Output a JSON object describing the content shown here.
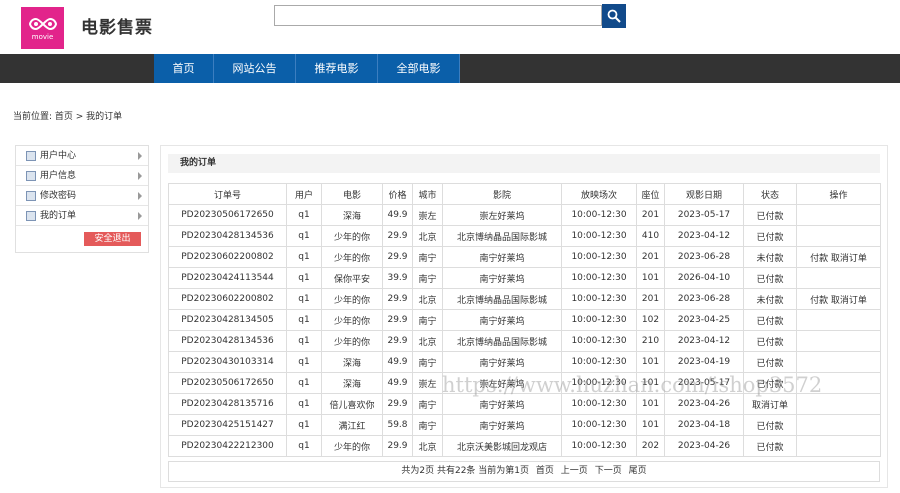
{
  "header": {
    "logo_text": "movie",
    "site_title": "电影售票",
    "search": {
      "value": "",
      "placeholder": ""
    }
  },
  "nav": [
    "首页",
    "网站公告",
    "推荐电影",
    "全部电影"
  ],
  "breadcrumb": "当前位置: 首页 > 我的订单",
  "sidebar": {
    "items": [
      "用户中心",
      "用户信息",
      "修改密码",
      "我的订单"
    ],
    "logout": "安全退出"
  },
  "content": {
    "title": "我的订单",
    "columns": [
      "订单号",
      "用户",
      "电影",
      "价格",
      "城市",
      "影院",
      "放映场次",
      "座位",
      "观影日期",
      "状态",
      "操作"
    ],
    "rows": [
      [
        "PD20230506172650",
        "q1",
        "深海",
        "49.9",
        "崇左",
        "崇左好莱坞",
        "10:00-12:30",
        "201",
        "2023-05-17",
        "已付款",
        ""
      ],
      [
        "PD20230428134536",
        "q1",
        "少年的你",
        "29.9",
        "北京",
        "北京博纳晶品国际影城",
        "10:00-12:30",
        "410",
        "2023-04-12",
        "已付款",
        ""
      ],
      [
        "PD20230602200802",
        "q1",
        "少年的你",
        "29.9",
        "南宁",
        "南宁好莱坞",
        "10:00-12:30",
        "201",
        "2023-06-28",
        "未付款",
        "付款 取消订单"
      ],
      [
        "PD20230424113544",
        "q1",
        "保你平安",
        "39.9",
        "南宁",
        "南宁好莱坞",
        "10:00-12:30",
        "101",
        "2026-04-10",
        "已付款",
        ""
      ],
      [
        "PD20230602200802",
        "q1",
        "少年的你",
        "29.9",
        "北京",
        "北京博纳晶品国际影城",
        "10:00-12:30",
        "201",
        "2023-06-28",
        "未付款",
        "付款 取消订单"
      ],
      [
        "PD20230428134505",
        "q1",
        "少年的你",
        "29.9",
        "南宁",
        "南宁好莱坞",
        "10:00-12:30",
        "102",
        "2023-04-25",
        "已付款",
        ""
      ],
      [
        "PD20230428134536",
        "q1",
        "少年的你",
        "29.9",
        "北京",
        "北京博纳晶品国际影城",
        "10:00-12:30",
        "210",
        "2023-04-12",
        "已付款",
        ""
      ],
      [
        "PD20230430103314",
        "q1",
        "深海",
        "49.9",
        "南宁",
        "南宁好莱坞",
        "10:00-12:30",
        "101",
        "2023-04-19",
        "已付款",
        ""
      ],
      [
        "PD20230506172650",
        "q1",
        "深海",
        "49.9",
        "崇左",
        "崇左好莱坞",
        "10:00-12:30",
        "101",
        "2023-05-17",
        "已付款",
        ""
      ],
      [
        "PD20230428135716",
        "q1",
        "倍儿喜欢你",
        "29.9",
        "南宁",
        "南宁好莱坞",
        "10:00-12:30",
        "101",
        "2023-04-26",
        "取消订单",
        ""
      ],
      [
        "PD20230425151427",
        "q1",
        "满江红",
        "59.8",
        "南宁",
        "南宁好莱坞",
        "10:00-12:30",
        "101",
        "2023-04-18",
        "已付款",
        ""
      ],
      [
        "PD20230422212300",
        "q1",
        "少年的你",
        "29.9",
        "北京",
        "北京沃美影城回龙观店",
        "10:00-12:30",
        "202",
        "2023-04-26",
        "已付款",
        ""
      ]
    ],
    "pager": {
      "summary": "共为2页 共有22条 当前为第1页",
      "first": "首页",
      "prev": "上一页",
      "next": "下一页",
      "last": "尾页"
    }
  },
  "watermark": "https://www.huzhan.com/ishop3572",
  "colors": {
    "brand_pink": "#e2248b",
    "nav_blue": "#0b5fa9",
    "nav_bar": "#333333",
    "logout_red": "#e45a5a"
  }
}
